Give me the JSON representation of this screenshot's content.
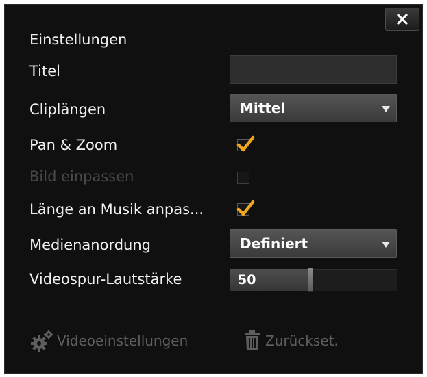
{
  "dialog": {
    "heading": "Einstellungen",
    "close_icon": "close-icon"
  },
  "settings": {
    "title": {
      "label": "Titel",
      "value": ""
    },
    "clip_length": {
      "label": "Cliplängen",
      "value": "Mittel"
    },
    "pan_zoom": {
      "label": "Pan & Zoom",
      "checked": true
    },
    "fit_image": {
      "label": "Bild einpassen",
      "checked": false,
      "disabled": true
    },
    "fit_to_music": {
      "label": "Länge an Musik anpas...",
      "checked": true
    },
    "media_order": {
      "label": "Medienanordung",
      "value": "Definiert"
    },
    "video_volume": {
      "label": "Videospur-Lautstärke",
      "value": "50"
    }
  },
  "footer": {
    "video_settings": {
      "label": "Videoeinstellungen",
      "icon": "gears-icon"
    },
    "reset": {
      "label": "Zurückset.",
      "icon": "trash-icon"
    }
  },
  "colors": {
    "background": "#101010",
    "checkmark": "#f2a81e",
    "text": "#f0f0f0",
    "disabled_text": "#4a4a4a"
  }
}
